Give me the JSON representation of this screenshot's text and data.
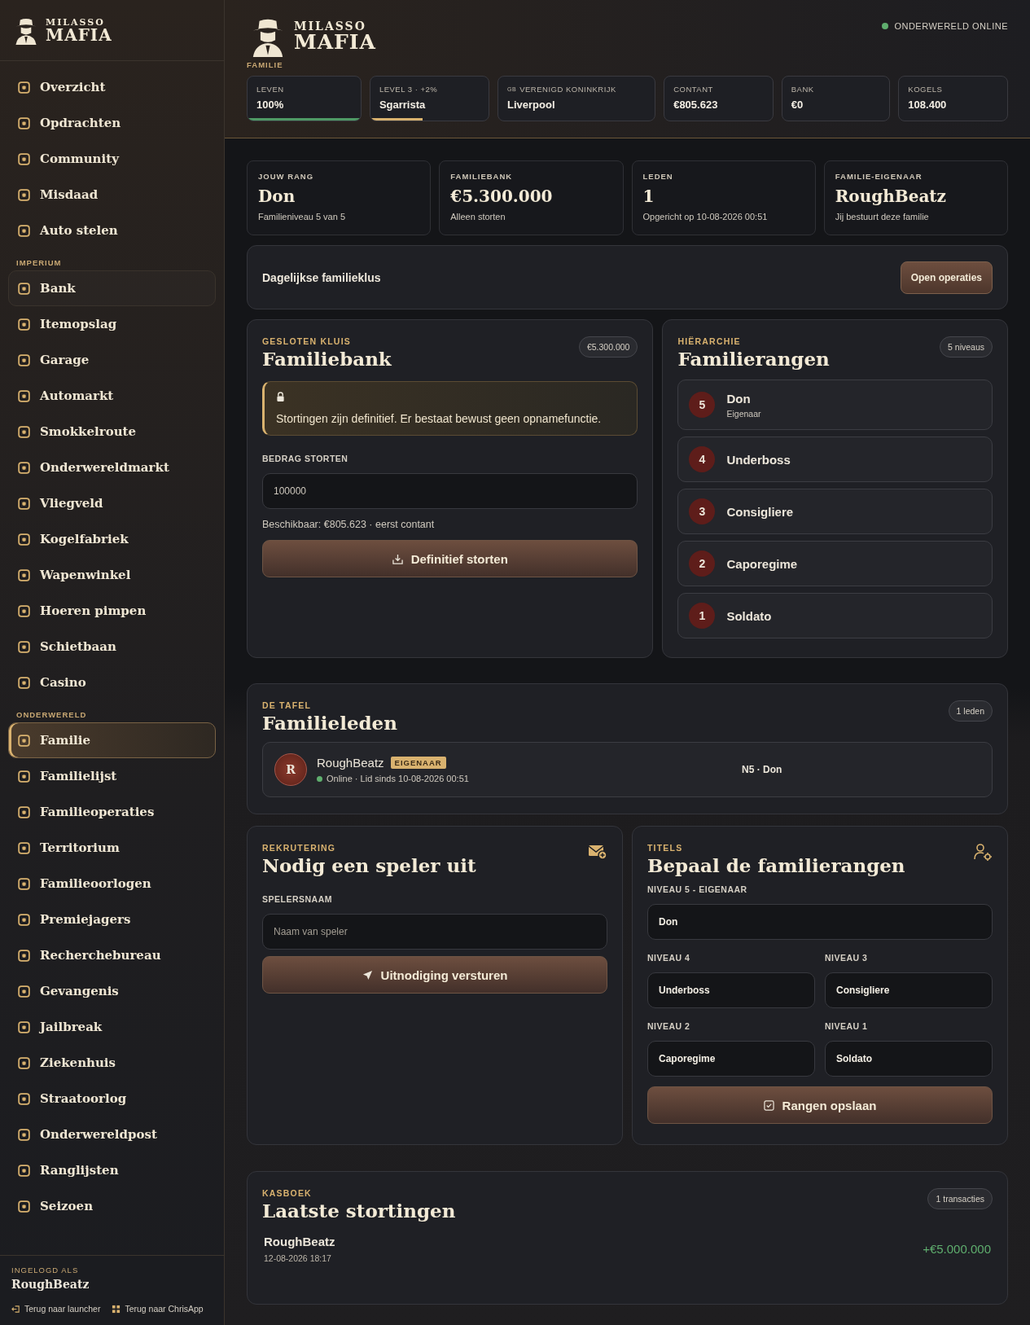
{
  "sidebar": {
    "brand": {
      "top": "MILASSO",
      "bottom": "MAFIA"
    },
    "groups": [
      {
        "items": [
          {
            "label": "Overzicht",
            "selected": false,
            "hovered": false
          },
          {
            "label": "Opdrachten",
            "selected": false,
            "hovered": false
          },
          {
            "label": "Community",
            "selected": false,
            "hovered": false
          },
          {
            "label": "Misdaad",
            "selected": false,
            "hovered": false
          },
          {
            "label": "Auto stelen",
            "selected": false,
            "hovered": false
          }
        ]
      },
      {
        "heading": "IMPERIUM",
        "items": [
          {
            "label": "Bank",
            "selected": false,
            "hovered": true
          },
          {
            "label": "Itemopslag",
            "selected": false,
            "hovered": false
          },
          {
            "label": "Garage",
            "selected": false,
            "hovered": false
          },
          {
            "label": "Automarkt",
            "selected": false,
            "hovered": false
          },
          {
            "label": "Smokkelroute",
            "selected": false,
            "hovered": false
          },
          {
            "label": "Onderwereldmarkt",
            "selected": false,
            "hovered": false
          },
          {
            "label": "Vliegveld",
            "selected": false,
            "hovered": false
          },
          {
            "label": "Kogelfabriek",
            "selected": false,
            "hovered": false
          },
          {
            "label": "Wapenwinkel",
            "selected": false,
            "hovered": false
          },
          {
            "label": "Hoeren pimpen",
            "selected": false,
            "hovered": false
          },
          {
            "label": "Schietbaan",
            "selected": false,
            "hovered": false
          },
          {
            "label": "Casino",
            "selected": false,
            "hovered": false
          }
        ]
      },
      {
        "heading": "ONDERWERELD",
        "items": [
          {
            "label": "Familie",
            "selected": true,
            "hovered": false
          },
          {
            "label": "Familielijst",
            "selected": false,
            "hovered": false
          },
          {
            "label": "Familieoperaties",
            "selected": false,
            "hovered": false
          },
          {
            "label": "Territorium",
            "selected": false,
            "hovered": false
          },
          {
            "label": "Familieoorlogen",
            "selected": false,
            "hovered": false
          },
          {
            "label": "Premiejagers",
            "selected": false,
            "hovered": false
          },
          {
            "label": "Recherchebureau",
            "selected": false,
            "hovered": false
          },
          {
            "label": "Gevangenis",
            "selected": false,
            "hovered": false
          },
          {
            "label": "Jailbreak",
            "selected": false,
            "hovered": false
          },
          {
            "label": "Ziekenhuis",
            "selected": false,
            "hovered": false
          },
          {
            "label": "Straatoorlog",
            "selected": false,
            "hovered": false
          },
          {
            "label": "Onderwereldpost",
            "selected": false,
            "hovered": false
          },
          {
            "label": "Ranglijsten",
            "selected": false,
            "hovered": false
          },
          {
            "label": "Seizoen",
            "selected": false,
            "hovered": false
          }
        ]
      }
    ],
    "footer": {
      "label": "INGELOGD ALS",
      "user": "RoughBeatz",
      "links": [
        "Terug naar launcher",
        "Terug naar ChrisApp"
      ]
    }
  },
  "header": {
    "brand": {
      "top": "MILASSO",
      "bottom": "MAFIA"
    },
    "page": "FAMILIE",
    "status": "ONDERWERELD ONLINE",
    "online": true,
    "stats": [
      {
        "label": "LEVEN",
        "value": "100%",
        "level": 1.0,
        "color": "#4f9a66"
      },
      {
        "label": "LEVEL 3 · +2%",
        "value": "Sgarrista",
        "level": 0.44,
        "color": "#d9b26f"
      },
      {
        "prefix": "GB",
        "label": "VERENIGD KONINKRIJK",
        "value": "Liverpool"
      },
      {
        "label": "CONTANT",
        "value": "€805.623"
      },
      {
        "label": "BANK",
        "value": "€0"
      },
      {
        "label": "KOGELS",
        "value": "108.400"
      }
    ]
  },
  "summary": [
    {
      "label": "JOUW RANG",
      "value": "Don",
      "sub": "Familieniveau 5 van 5"
    },
    {
      "label": "FAMILIEBANK",
      "value": "€5.300.000",
      "sub": "Alleen storten"
    },
    {
      "label": "LEDEN",
      "value": "1",
      "sub": "Opgericht op 10-08-2026 00:51"
    },
    {
      "label": "FAMILIE-EIGENAAR",
      "value": "RoughBeatz",
      "sub": "Jij bestuurt deze familie"
    }
  ],
  "daily": {
    "title": "Dagelijkse familieklus",
    "button": "Open operaties"
  },
  "bank": {
    "eyebrow": "GESLOTEN KLUIS",
    "title": "Familiebank",
    "badge": "€5.300.000",
    "notice": "Stortingen zijn definitief. Er bestaat bewust geen opnamefunctie.",
    "field_label": "BEDRAG STORTEN",
    "value": "100000",
    "hint": "Beschikbaar: €805.623 · eerst contant",
    "button": "Definitief storten"
  },
  "hierarchy": {
    "eyebrow": "HIËRARCHIE",
    "title": "Familierangen",
    "badge": "5 niveaus",
    "ranks": [
      {
        "number": "5",
        "name": "Don",
        "sub": "Eigenaar"
      },
      {
        "number": "4",
        "name": "Underboss"
      },
      {
        "number": "3",
        "name": "Consigliere"
      },
      {
        "number": "2",
        "name": "Caporegime"
      },
      {
        "number": "1",
        "name": "Soldato"
      }
    ]
  },
  "members": {
    "eyebrow": "DE TAFEL",
    "title": "Familieleden",
    "badge": "1 leden",
    "rows": [
      {
        "initial": "R",
        "name": "RoughBeatz",
        "tag": "EIGENAAR",
        "online": true,
        "since": "Online · Lid sinds 10-08-2026 00:51",
        "rank": "N5 · Don"
      }
    ]
  },
  "invite": {
    "eyebrow": "REKRUTERING",
    "title": "Nodig een speler uit",
    "field_label": "SPELERSNAAM",
    "placeholder": "Naam van speler",
    "button": "Uitnodiging versturen"
  },
  "titles": {
    "eyebrow": "TITELS",
    "title": "Bepaal de familierangen",
    "fields": [
      {
        "label": "NIVEAU 5 - EIGENAAR",
        "value": "Don"
      },
      {
        "label": "NIVEAU 4",
        "value": "Underboss"
      },
      {
        "label": "NIVEAU 3",
        "value": "Consigliere"
      },
      {
        "label": "NIVEAU 2",
        "value": "Caporegime"
      },
      {
        "label": "NIVEAU 1",
        "value": "Soldato"
      }
    ],
    "button": "Rangen opslaan"
  },
  "ledger": {
    "eyebrow": "KASBOEK",
    "title": "Laatste stortingen",
    "badge": "1 transacties",
    "rows": [
      {
        "name": "RoughBeatz",
        "date": "12-08-2026 18:17",
        "amount": "+€5.000.000"
      }
    ]
  }
}
